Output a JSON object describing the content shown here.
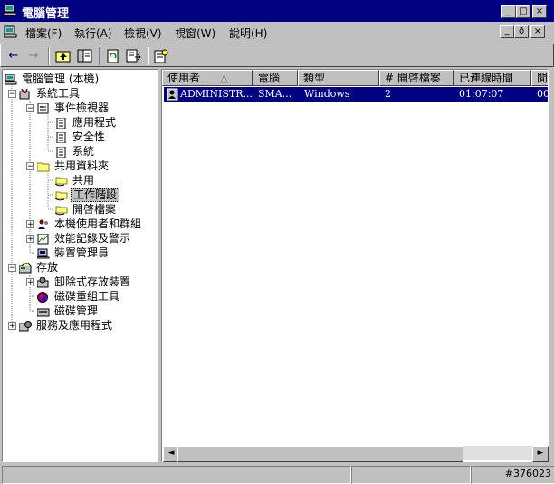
{
  "window": {
    "title": "電腦管理",
    "controls": [
      "_",
      "□",
      "×"
    ]
  },
  "menu": {
    "items": [
      "檔案(F)",
      "執行(A)",
      "檢視(V)",
      "視窗(W)",
      "說明(H)"
    ],
    "mdi_controls": [
      "_",
      "ð",
      "×"
    ]
  },
  "toolbar": {
    "buttons": [
      "←",
      "→",
      "up-folder-icon",
      "show-tree-icon",
      "refresh-icon",
      "export-icon",
      "properties-icon"
    ]
  },
  "tree": {
    "root": "電腦管理 (本機)",
    "system_tools": "系統工具",
    "event_viewer": "事件檢視器",
    "application": "應用程式",
    "security": "安全性",
    "system": "系統",
    "shared_folders": "共用資料夾",
    "shares": "共用",
    "sessions": "工作階段",
    "open_files": "開啓檔案",
    "local_users": "本機使用者和群組",
    "perf_logs": "效能記錄及警示",
    "device_manager": "裝置管理員",
    "storage": "存放",
    "removable_storage": "卸除式存放裝置",
    "defrag": "磁碟重組工具",
    "disk_mgmt": "磁碟管理",
    "services_apps": "服務及應用程式"
  },
  "list": {
    "columns": [
      "使用者",
      "電腦",
      "類型",
      "# 開啓檔案",
      "已連線時間",
      "閒"
    ],
    "sort_indicator": "△",
    "rows": [
      {
        "user": "ADMINISTR...",
        "computer": "SMA...",
        "type": "Windows",
        "open_files": "2",
        "connected": "01:07:07",
        "idle": "00"
      }
    ]
  },
  "scrollbar": {
    "left": "◄",
    "right": "►"
  },
  "status": {
    "right_text": "#376023"
  }
}
